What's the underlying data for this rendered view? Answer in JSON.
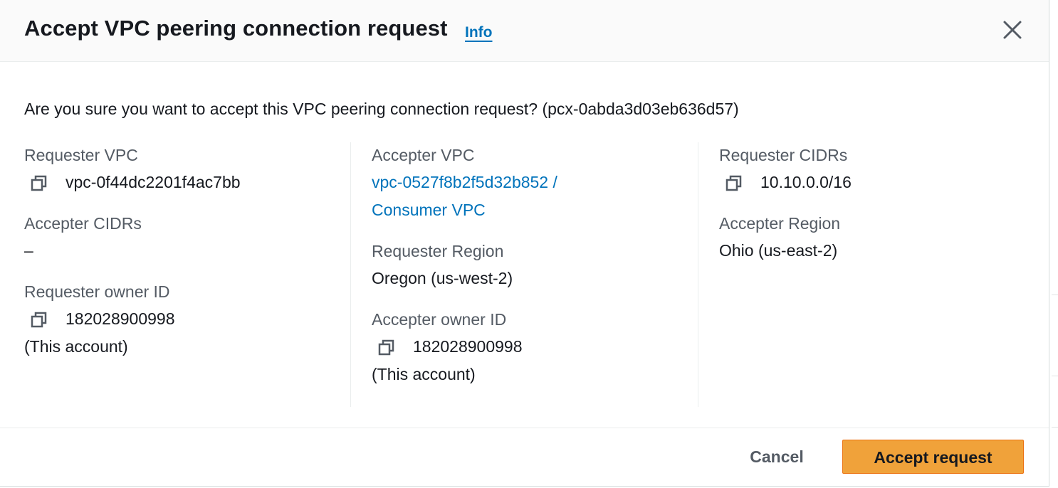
{
  "dialog": {
    "title": "Accept VPC peering connection request",
    "info_label": "Info",
    "prompt": "Are you sure you want to accept this VPC peering connection request? (pcx-0abda3d03eb636d57)"
  },
  "details": {
    "requester_vpc": {
      "label": "Requester VPC",
      "value": "vpc-0f44dc2201f4ac7bb"
    },
    "accepter_cidrs": {
      "label": "Accepter CIDRs",
      "value": "–"
    },
    "requester_owner_id": {
      "label": "Requester owner ID",
      "value": "182028900998",
      "note": "(This account)"
    },
    "accepter_vpc": {
      "label": "Accepter VPC",
      "value_line1": "vpc-0527f8b2f5d32b852 /",
      "value_line2": "Consumer VPC"
    },
    "requester_region": {
      "label": "Requester Region",
      "value": "Oregon (us-west-2)"
    },
    "accepter_owner_id": {
      "label": "Accepter owner ID",
      "value": "182028900998",
      "note": "(This account)"
    },
    "requester_cidrs": {
      "label": "Requester CIDRs",
      "value": "10.10.0.0/16"
    },
    "accepter_region": {
      "label": "Accepter Region",
      "value": "Ohio (us-east-2)"
    }
  },
  "footer": {
    "cancel_label": "Cancel",
    "accept_label": "Accept request"
  },
  "icons": {
    "close": "close-icon",
    "copy": "copy-icon"
  },
  "colors": {
    "link": "#0073bb",
    "primary_button": "#f0a23a",
    "label": "#545b64",
    "text": "#16191f"
  }
}
